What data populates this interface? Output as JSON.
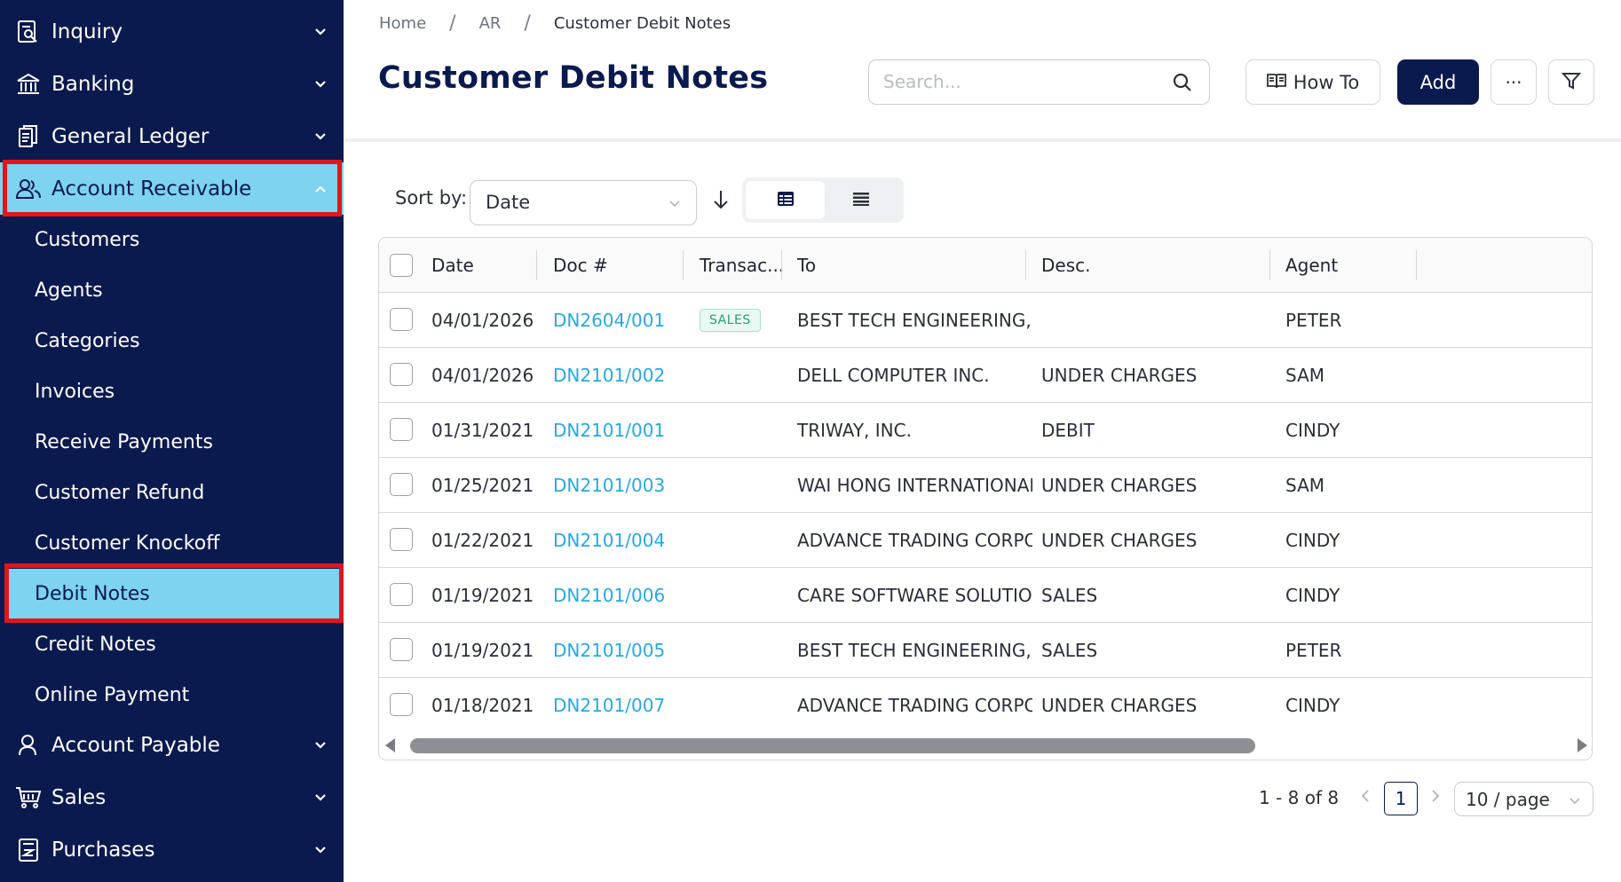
{
  "sidebar": {
    "groups": [
      {
        "label": "Inquiry",
        "icon": "inquiry-icon"
      },
      {
        "label": "Banking",
        "icon": "bank-icon"
      },
      {
        "label": "General Ledger",
        "icon": "ledger-icon"
      },
      {
        "label": "Account Receivable",
        "icon": "users-icon"
      },
      {
        "label": "Account Payable",
        "icon": "user-icon"
      },
      {
        "label": "Sales",
        "icon": "cart-icon"
      },
      {
        "label": "Purchases",
        "icon": "purchase-doc-icon"
      }
    ],
    "ar_items": [
      {
        "label": "Customers"
      },
      {
        "label": "Agents"
      },
      {
        "label": "Categories"
      },
      {
        "label": "Invoices"
      },
      {
        "label": "Receive Payments"
      },
      {
        "label": "Customer Refund"
      },
      {
        "label": "Customer Knockoff"
      },
      {
        "label": "Debit Notes"
      },
      {
        "label": "Credit Notes"
      },
      {
        "label": "Online Payment"
      }
    ],
    "active_group": "Account Receivable",
    "active_item": "Debit Notes"
  },
  "breadcrumb": [
    "Home",
    "AR",
    "Customer Debit Notes"
  ],
  "page_title": "Customer Debit Notes",
  "search": {
    "placeholder": "Search...",
    "value": ""
  },
  "toolbar": {
    "howto_label": "How To",
    "add_label": "Add",
    "more_label": "···"
  },
  "sort": {
    "label": "Sort by:",
    "value": "Date",
    "direction": "descending"
  },
  "table": {
    "columns": [
      "Date",
      "Doc #",
      "Transac...",
      "To",
      "Desc.",
      "Agent"
    ],
    "rows": [
      {
        "date": "04/01/2026",
        "doc": "DN2604/001",
        "transaction": "SALES",
        "to": "BEST TECH ENGINEERING, INC.",
        "desc": "",
        "agent": "PETER"
      },
      {
        "date": "04/01/2026",
        "doc": "DN2101/002",
        "transaction": "",
        "to": "DELL COMPUTER INC.",
        "desc": "UNDER CHARGES",
        "agent": "SAM"
      },
      {
        "date": "01/31/2021",
        "doc": "DN2101/001",
        "transaction": "",
        "to": "TRIWAY, INC.",
        "desc": "DEBIT",
        "agent": "CINDY"
      },
      {
        "date": "01/25/2021",
        "doc": "DN2101/003",
        "transaction": "",
        "to": "WAI HONG INTERNATIONAL TRA",
        "desc": "UNDER CHARGES",
        "agent": "SAM"
      },
      {
        "date": "01/22/2021",
        "doc": "DN2101/004",
        "transaction": "",
        "to": "ADVANCE TRADING CORPORAT",
        "desc": "UNDER CHARGES",
        "agent": "CINDY"
      },
      {
        "date": "01/19/2021",
        "doc": "DN2101/006",
        "transaction": "",
        "to": "CARE SOFTWARE SOLUTIONS, IN",
        "desc": "SALES",
        "agent": "CINDY"
      },
      {
        "date": "01/19/2021",
        "doc": "DN2101/005",
        "transaction": "",
        "to": "BEST TECH ENGINEERING, INC.",
        "desc": "SALES",
        "agent": "PETER"
      },
      {
        "date": "01/18/2021",
        "doc": "DN2101/007",
        "transaction": "",
        "to": "ADVANCE TRADING CORPORAT",
        "desc": "UNDER CHARGES",
        "agent": "CINDY"
      }
    ]
  },
  "pagination": {
    "total_text": "1 - 8 of 8",
    "current_page": "1",
    "page_size": "10 / page"
  },
  "colors": {
    "sidebar_bg": "#0b1a4e",
    "active_bg": "#7dd3f0",
    "highlight_border": "#e0161c",
    "link": "#2aa7e0",
    "primary_button": "#0b1a4e"
  }
}
